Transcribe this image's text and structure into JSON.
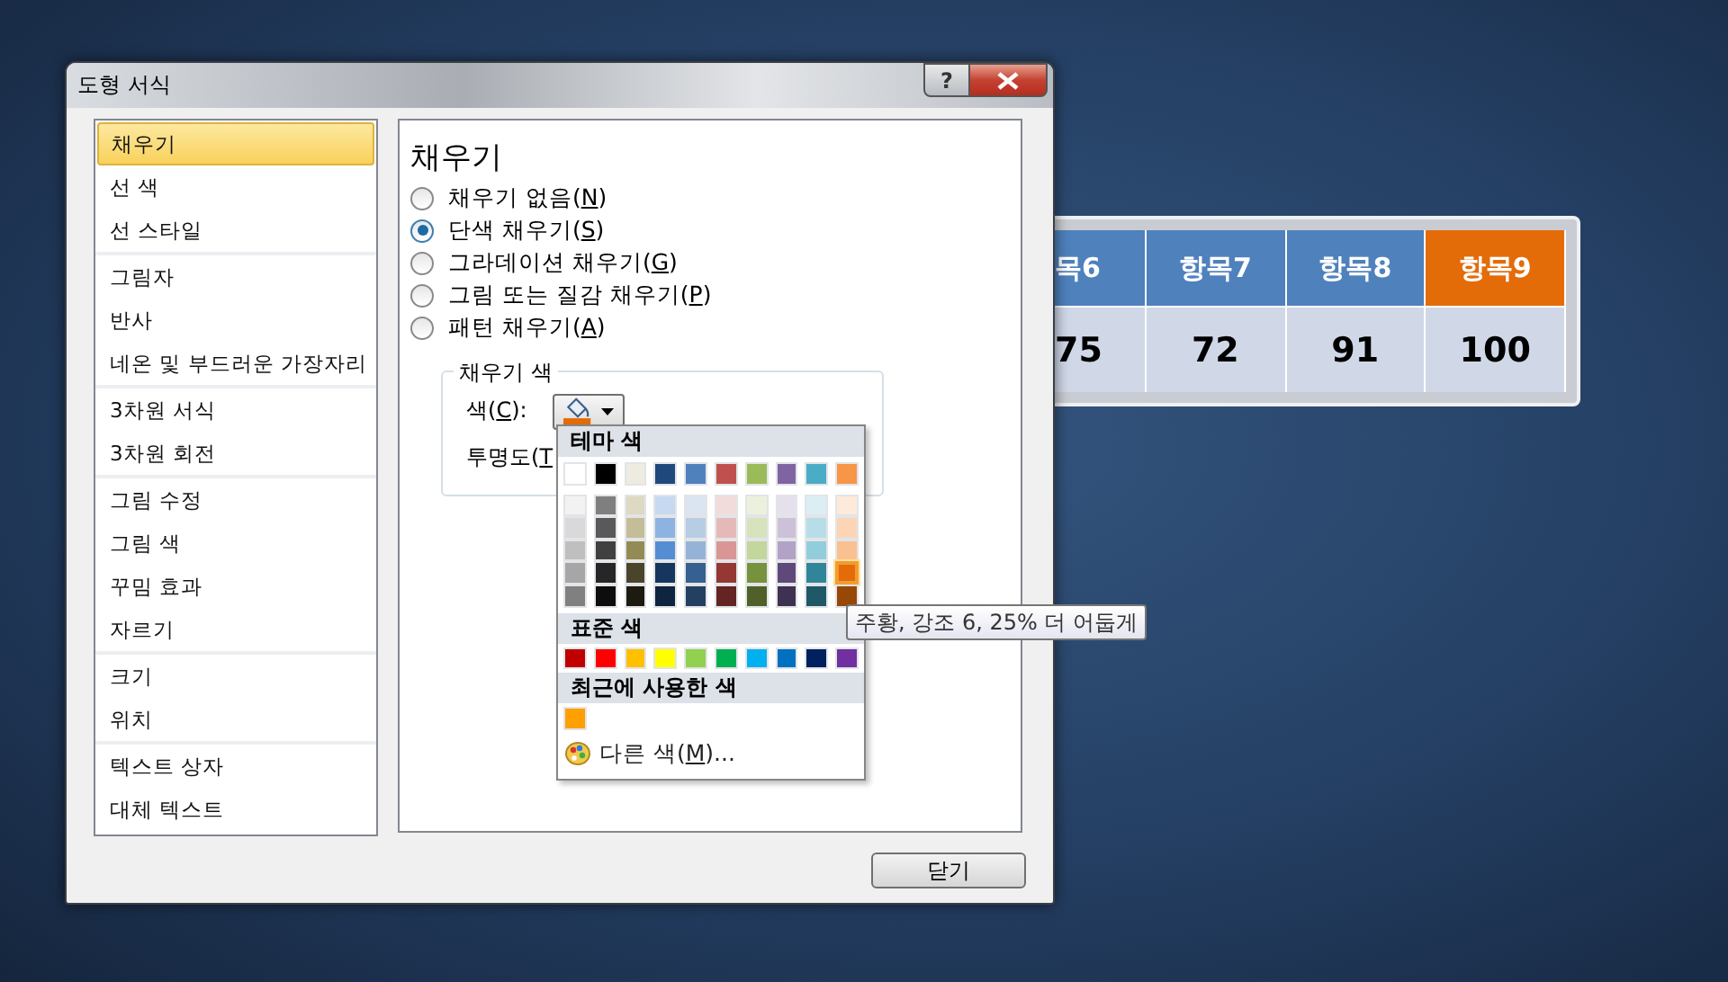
{
  "dialog": {
    "title": "도형 서식",
    "help_label": "?"
  },
  "category_groups": [
    {
      "items": [
        {
          "label": "채우기",
          "selected": true
        },
        {
          "label": "선 색",
          "selected": false
        },
        {
          "label": "선 스타일",
          "selected": false
        }
      ]
    },
    {
      "items": [
        {
          "label": "그림자",
          "selected": false
        },
        {
          "label": "반사",
          "selected": false
        },
        {
          "label": "네온 및 부드러운 가장자리",
          "selected": false
        }
      ]
    },
    {
      "items": [
        {
          "label": "3차원 서식",
          "selected": false
        },
        {
          "label": "3차원 회전",
          "selected": false
        }
      ]
    },
    {
      "items": [
        {
          "label": "그림 수정",
          "selected": false
        },
        {
          "label": "그림 색",
          "selected": false
        },
        {
          "label": "꾸밈 효과",
          "selected": false
        },
        {
          "label": "자르기",
          "selected": false
        }
      ]
    },
    {
      "items": [
        {
          "label": "크기",
          "selected": false
        },
        {
          "label": "위치",
          "selected": false
        }
      ]
    },
    {
      "items": [
        {
          "label": "텍스트 상자",
          "selected": false
        },
        {
          "label": "대체 텍스트",
          "selected": false
        }
      ]
    }
  ],
  "panel": {
    "heading": "채우기",
    "fill_options": [
      {
        "prefix": "채우기 없음(",
        "access_key": "N",
        "suffix": ")",
        "selected": false
      },
      {
        "prefix": "단색 채우기(",
        "access_key": "S",
        "suffix": ")",
        "selected": true
      },
      {
        "prefix": "그라데이션 채우기(",
        "access_key": "G",
        "suffix": ")",
        "selected": false
      },
      {
        "prefix": "그림 또는 질감 채우기(",
        "access_key": "P",
        "suffix": ")",
        "selected": false
      },
      {
        "prefix": "패턴 채우기(",
        "access_key": "A",
        "suffix": ")",
        "selected": false
      }
    ],
    "fill_color": {
      "legend": "채우기 색",
      "color_label": {
        "prefix": "색(",
        "access_key": "C",
        "suffix": "):"
      },
      "color": "#e36c09",
      "transparency_label": {
        "prefix": "투명도(",
        "access_key": "T"
      }
    }
  },
  "color_menu": {
    "theme_header": "테마 색",
    "theme_base": [
      {
        "color": "#ffffff",
        "selected": false
      },
      {
        "color": "#000000",
        "selected": false
      },
      {
        "color": "#eeece1",
        "selected": false
      },
      {
        "color": "#1f497d",
        "selected": false
      },
      {
        "color": "#4f81bd",
        "selected": false
      },
      {
        "color": "#c0504d",
        "selected": false
      },
      {
        "color": "#9bbb59",
        "selected": false
      },
      {
        "color": "#8064a2",
        "selected": false
      },
      {
        "color": "#4bacc6",
        "selected": false
      },
      {
        "color": "#f79646",
        "selected": false
      }
    ],
    "theme_shades": [
      [
        {
          "color": "#f2f2f2",
          "selected": false
        },
        {
          "color": "#7f7f7f",
          "selected": false
        },
        {
          "color": "#ddd9c3",
          "selected": false
        },
        {
          "color": "#c6d9f0",
          "selected": false
        },
        {
          "color": "#dbe5f1",
          "selected": false
        },
        {
          "color": "#f2dcdb",
          "selected": false
        },
        {
          "color": "#ebf1dd",
          "selected": false
        },
        {
          "color": "#e5e0ec",
          "selected": false
        },
        {
          "color": "#dbeef3",
          "selected": false
        },
        {
          "color": "#fdeada",
          "selected": false
        }
      ],
      [
        {
          "color": "#d9d9d9",
          "selected": false
        },
        {
          "color": "#595959",
          "selected": false
        },
        {
          "color": "#c4bd97",
          "selected": false
        },
        {
          "color": "#8db3e2",
          "selected": false
        },
        {
          "color": "#b8cce4",
          "selected": false
        },
        {
          "color": "#e5b9b7",
          "selected": false
        },
        {
          "color": "#d7e3bc",
          "selected": false
        },
        {
          "color": "#ccc1d9",
          "selected": false
        },
        {
          "color": "#b7dde8",
          "selected": false
        },
        {
          "color": "#fbd5b5",
          "selected": false
        }
      ],
      [
        {
          "color": "#bfbfbf",
          "selected": false
        },
        {
          "color": "#404040",
          "selected": false
        },
        {
          "color": "#948a54",
          "selected": false
        },
        {
          "color": "#548dd4",
          "selected": false
        },
        {
          "color": "#95b3d7",
          "selected": false
        },
        {
          "color": "#d99694",
          "selected": false
        },
        {
          "color": "#c3d69b",
          "selected": false
        },
        {
          "color": "#b2a2c7",
          "selected": false
        },
        {
          "color": "#92cddc",
          "selected": false
        },
        {
          "color": "#fac08f",
          "selected": false
        }
      ],
      [
        {
          "color": "#a6a6a6",
          "selected": false
        },
        {
          "color": "#262626",
          "selected": false
        },
        {
          "color": "#4a452a",
          "selected": false
        },
        {
          "color": "#17365d",
          "selected": false
        },
        {
          "color": "#366092",
          "selected": false
        },
        {
          "color": "#953734",
          "selected": false
        },
        {
          "color": "#76923c",
          "selected": false
        },
        {
          "color": "#5f497a",
          "selected": false
        },
        {
          "color": "#31859b",
          "selected": false
        },
        {
          "color": "#e36c09",
          "selected": true
        }
      ],
      [
        {
          "color": "#808080",
          "selected": false
        },
        {
          "color": "#0d0d0d",
          "selected": false
        },
        {
          "color": "#1d1b10",
          "selected": false
        },
        {
          "color": "#0f243e",
          "selected": false
        },
        {
          "color": "#244061",
          "selected": false
        },
        {
          "color": "#632423",
          "selected": false
        },
        {
          "color": "#4f6128",
          "selected": false
        },
        {
          "color": "#3f3151",
          "selected": false
        },
        {
          "color": "#205867",
          "selected": false
        },
        {
          "color": "#974806",
          "selected": false
        }
      ]
    ],
    "standard_header": "표준 색",
    "standard": [
      {
        "color": "#c00000",
        "selected": false
      },
      {
        "color": "#ff0000",
        "selected": false
      },
      {
        "color": "#ffc000",
        "selected": false
      },
      {
        "color": "#ffff00",
        "selected": false
      },
      {
        "color": "#92d050",
        "selected": false
      },
      {
        "color": "#00b050",
        "selected": false
      },
      {
        "color": "#00b0f0",
        "selected": false
      },
      {
        "color": "#0070c0",
        "selected": false
      },
      {
        "color": "#002060",
        "selected": false
      },
      {
        "color": "#7030a0",
        "selected": false
      }
    ],
    "recent_header": "최근에 사용한 색",
    "recent": [
      {
        "color": "#ff9f00",
        "selected": false
      }
    ],
    "more_colors": {
      "prefix": "다른 색(",
      "access_key": "M",
      "suffix": ")..."
    }
  },
  "tooltip": "주황, 강조 6, 25% 더 어둡게",
  "close_label": "닫기",
  "table": {
    "headers": [
      {
        "text": "목6",
        "color": "#4f81bd"
      },
      {
        "text": "항목7",
        "color": "#4f81bd"
      },
      {
        "text": "항목8",
        "color": "#4f81bd"
      },
      {
        "text": "항목9",
        "color": "#e36c09"
      }
    ],
    "values": [
      "75",
      "72",
      "91",
      "100"
    ]
  }
}
